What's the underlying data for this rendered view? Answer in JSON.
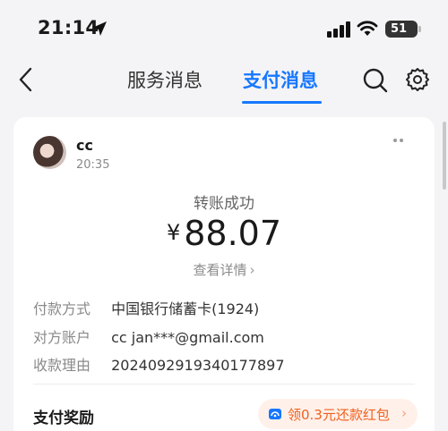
{
  "status_bar": {
    "time": "21:14",
    "battery": "51"
  },
  "nav": {
    "tabs": [
      "服务消息",
      "支付消息"
    ],
    "active_tab": "支付消息"
  },
  "message": {
    "sender": "cc",
    "time": "20:35",
    "title": "转账成功",
    "currency": "¥",
    "amount": "88.07",
    "details_link": "查看详情",
    "rows": [
      {
        "label": "付款方式",
        "value": "中国银行储蓄卡(1924)"
      },
      {
        "label": "对方账户",
        "value": "cc jan***@gmail.com"
      },
      {
        "label": "收款理由",
        "value": "2024092919340177897"
      }
    ],
    "reward": {
      "label": "支付奖励",
      "offer": "领0.3元还款红包"
    }
  },
  "colors": {
    "accent": "#1677ff",
    "reward": "#f0601e",
    "reward_bg": "#fff1ea"
  },
  "icons": [
    "location-arrow-icon",
    "signal-icon",
    "wifi-icon",
    "battery-icon",
    "back-icon",
    "search-icon",
    "gear-icon",
    "more-icon",
    "reward-icon",
    "chevron-right-icon"
  ]
}
